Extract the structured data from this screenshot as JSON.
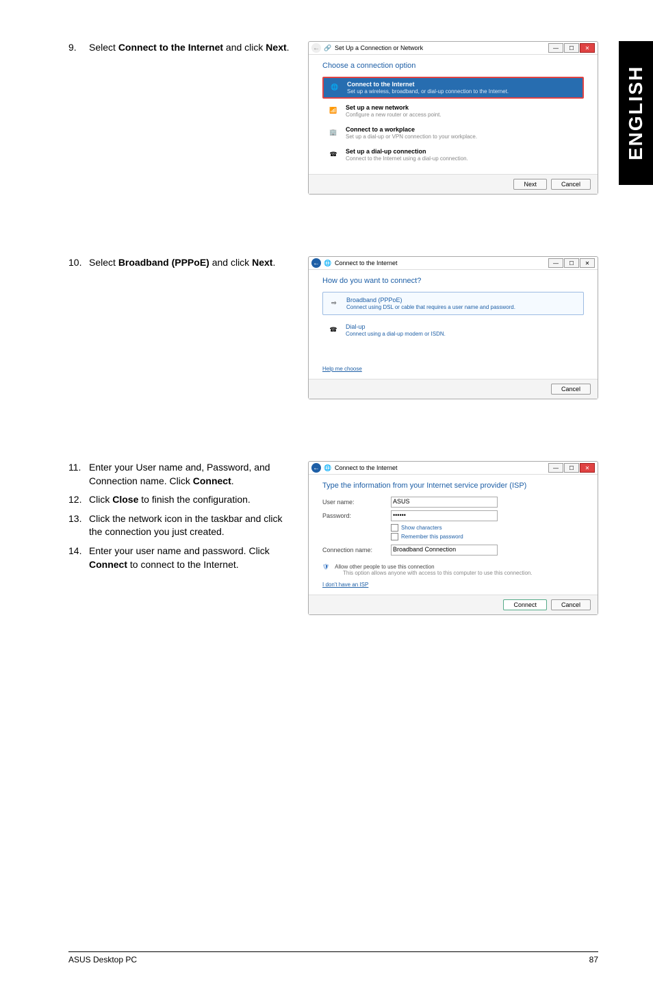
{
  "sideTab": "ENGLISH",
  "block1": {
    "stepNum": "9.",
    "stepPrefix": "Select ",
    "stepBold": "Connect to the Internet",
    "stepMid": " and click ",
    "stepBold2": "Next",
    "stepSuffix": ".",
    "dialog": {
      "title": "Set Up a Connection or Network",
      "heading": "Choose a connection option",
      "opt1": {
        "title": "Connect to the Internet",
        "sub": "Set up a wireless, broadband, or dial-up connection to the Internet."
      },
      "opt2": {
        "title": "Set up a new network",
        "sub": "Configure a new router or access point."
      },
      "opt3": {
        "title": "Connect to a workplace",
        "sub": "Set up a dial-up or VPN connection to your workplace."
      },
      "opt4": {
        "title": "Set up a dial-up connection",
        "sub": "Connect to the Internet using a dial-up connection."
      },
      "btnNext": "Next",
      "btnCancel": "Cancel"
    }
  },
  "block2": {
    "stepNum": "10.",
    "stepPrefix": "Select ",
    "stepBold": "Broadband (PPPoE)",
    "stepMid": " and click ",
    "stepBold2": "Next",
    "stepSuffix": ".",
    "dialog": {
      "title": "Connect to the Internet",
      "heading": "How do you want to connect?",
      "opt1": {
        "title": "Broadband (PPPoE)",
        "sub": "Connect using DSL or cable that requires a user name and password."
      },
      "opt2": {
        "title": "Dial-up",
        "sub": "Connect using a dial-up modem or ISDN."
      },
      "help": "Help me choose",
      "btnCancel": "Cancel"
    }
  },
  "block3": {
    "steps": [
      {
        "num": "11.",
        "pre": "Enter your User name and, Password, and Connection name. Click ",
        "b": "Connect",
        "post": "."
      },
      {
        "num": "12.",
        "pre": "Click ",
        "b": "Close",
        "post": " to finish the configuration."
      },
      {
        "num": "13.",
        "full": "Click the network icon in the taskbar and click the connection you just created."
      },
      {
        "num": "14.",
        "pre": "Enter your user name and password. Click ",
        "b": "Connect",
        "post": " to connect to the Internet."
      }
    ],
    "dialog": {
      "title": "Connect to the Internet",
      "heading": "Type the information from your Internet service provider (ISP)",
      "lblUser": "User name:",
      "valUser": "ASUS",
      "lblPass": "Password:",
      "valPass": "••••••",
      "chkShow": "Show characters",
      "chkRemember": "Remember this password",
      "lblConn": "Connection name:",
      "valConn": "Broadband Connection",
      "allow": "Allow other people to use this connection",
      "allowSub": "This option allows anyone with access to this computer to use this connection.",
      "noIsp": "I don't have an ISP",
      "btnConnect": "Connect",
      "btnCancel": "Cancel"
    }
  },
  "footer": {
    "left": "ASUS Desktop PC",
    "right": "87"
  }
}
